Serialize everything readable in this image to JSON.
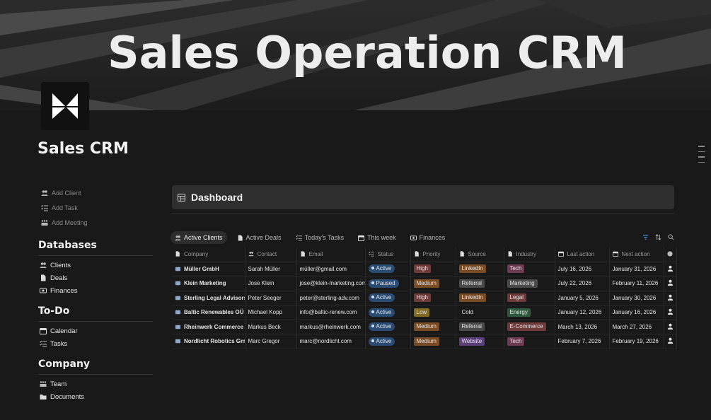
{
  "cover": {
    "title": "Sales Operation CRM"
  },
  "page": {
    "title": "Sales CRM"
  },
  "sidebar": {
    "quick_actions": [
      {
        "label": "Add Client",
        "icon": "people-icon"
      },
      {
        "label": "Add Task",
        "icon": "checklist-icon"
      },
      {
        "label": "Add Meeting",
        "icon": "team-icon"
      }
    ],
    "sections": [
      {
        "title": "Databases",
        "items": [
          {
            "label": "Clients",
            "icon": "people-icon"
          },
          {
            "label": "Deals",
            "icon": "document-icon"
          },
          {
            "label": "Finances",
            "icon": "money-icon"
          }
        ]
      },
      {
        "title": "To-Do",
        "items": [
          {
            "label": "Calendar",
            "icon": "calendar-icon"
          },
          {
            "label": "Tasks",
            "icon": "checklist-icon"
          }
        ]
      },
      {
        "title": "Company",
        "items": [
          {
            "label": "Team",
            "icon": "team-icon"
          },
          {
            "label": "Documents",
            "icon": "folder-icon"
          }
        ]
      }
    ]
  },
  "dashboard": {
    "title": "Dashboard"
  },
  "tabs": [
    {
      "label": "Active Clients",
      "active": true
    },
    {
      "label": "Active Deals",
      "active": false
    },
    {
      "label": "Today's Tasks",
      "active": false
    },
    {
      "label": "This week",
      "active": false
    },
    {
      "label": "Finances",
      "active": false
    }
  ],
  "table": {
    "columns": [
      "Company",
      "Contact",
      "Email",
      "Status",
      "Priority",
      "Source",
      "Industry",
      "Last action",
      "Next action"
    ],
    "rows": [
      {
        "company": "Müller GmbH",
        "contact": "Sarah Müller",
        "email": "müller@gmail.com",
        "status": "Active",
        "priority": "High",
        "source": "LinkedIn",
        "industry": "Tech",
        "last": "July 16, 2026",
        "next": "January 31, 2026"
      },
      {
        "company": "Klein Marketing",
        "contact": "Jose Klein",
        "email": "jose@klein-marketing.com",
        "status": "Paused",
        "priority": "Medium",
        "source": "Referral",
        "industry": "Marketing",
        "last": "July 22, 2026",
        "next": "February 11, 2026"
      },
      {
        "company": "Sterling Legal Advisors",
        "contact": "Peter Seeger",
        "email": "peter@sterling-adv.com",
        "status": "Active",
        "priority": "High",
        "source": "LinkedIn",
        "industry": "Legal",
        "last": "January 5, 2026",
        "next": "January 30, 2026"
      },
      {
        "company": "Baltic Renewables OÜ",
        "contact": "Michael Kopp",
        "email": "info@baltic-renew.com",
        "status": "Active",
        "priority": "Low",
        "source": "Cold",
        "industry": "Energy",
        "last": "January 12, 2026",
        "next": "January 16, 2026"
      },
      {
        "company": "Rheinwerk Commerce GmbH",
        "contact": "Markus Beck",
        "email": "markus@rheinwerk.com",
        "status": "Active",
        "priority": "Medium",
        "source": "Referral",
        "industry": "E-Commerce",
        "last": "March 13, 2026",
        "next": "March 27, 2026"
      },
      {
        "company": "Nordlicht Robotics GmbH",
        "contact": "Marc Gregor",
        "email": "marc@nordlicht.com",
        "status": "Active",
        "priority": "Medium",
        "source": "Website",
        "industry": "Tech",
        "last": "February 7, 2026",
        "next": "February 19, 2026"
      }
    ]
  },
  "colors": {
    "status": {
      "Active": "#2a4b73",
      "Paused": "#2a4b73"
    },
    "priority": {
      "High": "#6e3a3a",
      "Medium": "#7a4c26",
      "Low": "#806a24"
    },
    "source": {
      "LinkedIn": "#7a4c26",
      "Referral": "#4a4a4a",
      "Cold": "transparent",
      "Website": "#5b3f78"
    },
    "industry": {
      "Tech": "#6d3a52",
      "Marketing": "#4a4a4a",
      "Legal": "#6e3a3a",
      "Energy": "#2f5a3e",
      "E-Commerce": "#6e3a3a"
    }
  }
}
